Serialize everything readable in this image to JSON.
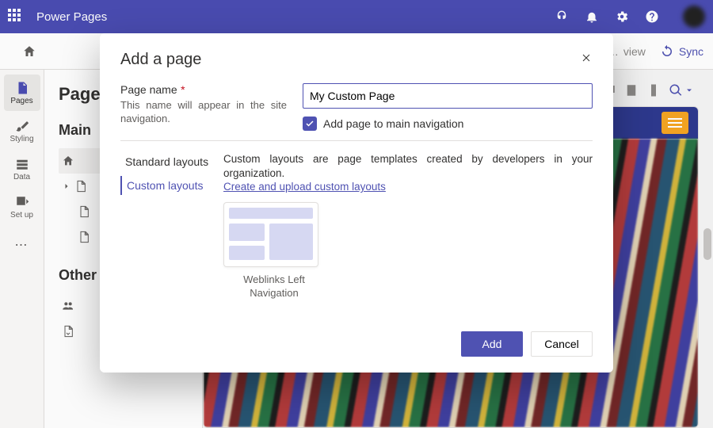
{
  "app": {
    "title": "Power Pages"
  },
  "subbar": {
    "preview": "view",
    "sync": "Sync"
  },
  "rail": {
    "items": [
      {
        "label": "Pages"
      },
      {
        "label": "Styling"
      },
      {
        "label": "Data"
      },
      {
        "label": "Set up"
      }
    ]
  },
  "panel": {
    "title": "Page",
    "section1": "Main ",
    "section2": "Other"
  },
  "modal": {
    "title": "Add a page",
    "pageNameLabel": "Page name",
    "required": "*",
    "hint": "This name will appear in the site navigation.",
    "pageNameValue": "My Custom Page",
    "checkboxLabel": "Add page to main navigation",
    "tabs": {
      "standard": "Standard layouts",
      "custom": "Custom layouts"
    },
    "customDesc": "Custom layouts are page templates created by developers in your organization.",
    "customLink": "Create and upload custom layouts",
    "layoutCard": "Weblinks Left Navigation",
    "addBtn": "Add",
    "cancelBtn": "Cancel"
  }
}
